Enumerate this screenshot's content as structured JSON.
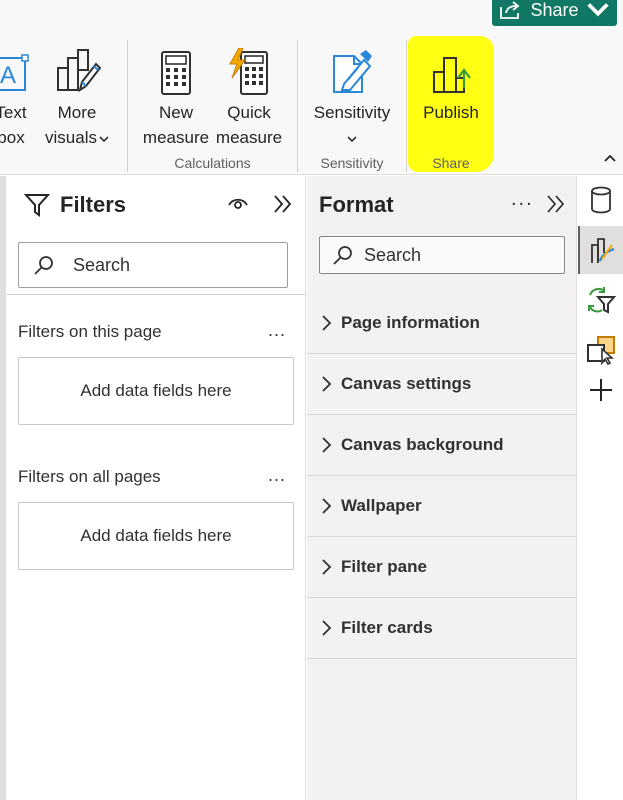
{
  "header": {
    "share_label": "Share",
    "share_icon": "share-icon",
    "share_chevron": "chevron-down-icon"
  },
  "ribbon": {
    "text_box": {
      "line1": "Text",
      "line2": "box",
      "icon": "text-box-icon"
    },
    "more_visuals": {
      "line1": "More",
      "line2": "visuals",
      "icon": "more-visuals-icon"
    },
    "new_measure": {
      "line1": "New",
      "line2": "measure",
      "icon": "calculator-icon"
    },
    "quick_measure": {
      "line1": "Quick",
      "line2": "measure",
      "icon": "quick-measure-icon"
    },
    "sensitivity": {
      "label": "Sensitivity",
      "icon": "sensitivity-icon"
    },
    "publish": {
      "label": "Publish",
      "icon": "publish-icon",
      "highlight_color": "#ffff14"
    },
    "groups": {
      "calculations": "Calculations",
      "sensitivity": "Sensitivity",
      "share": "Share"
    }
  },
  "filters": {
    "title": "Filters",
    "search_placeholder": "Search",
    "section_page": "Filters on this page",
    "section_all": "Filters on all pages",
    "add_fields_page": "Add data fields here",
    "add_fields_all": "Add data fields here",
    "more": "..."
  },
  "format": {
    "title": "Format",
    "search_placeholder": "Search",
    "more": "...",
    "cards": [
      {
        "label": "Page information"
      },
      {
        "label": "Canvas settings"
      },
      {
        "label": "Canvas background"
      },
      {
        "label": "Wallpaper"
      },
      {
        "label": "Filter pane"
      },
      {
        "label": "Filter cards"
      }
    ]
  },
  "rail": {
    "items": [
      "data-icon",
      "format-visual-icon",
      "sync-filter-icon",
      "selection-icon",
      "add-icon"
    ]
  },
  "colors": {
    "accent": "#117865",
    "ribbon_bg": "#f8f8f8",
    "format_bg": "#f3f2f1",
    "highlight": "#ffff14"
  }
}
